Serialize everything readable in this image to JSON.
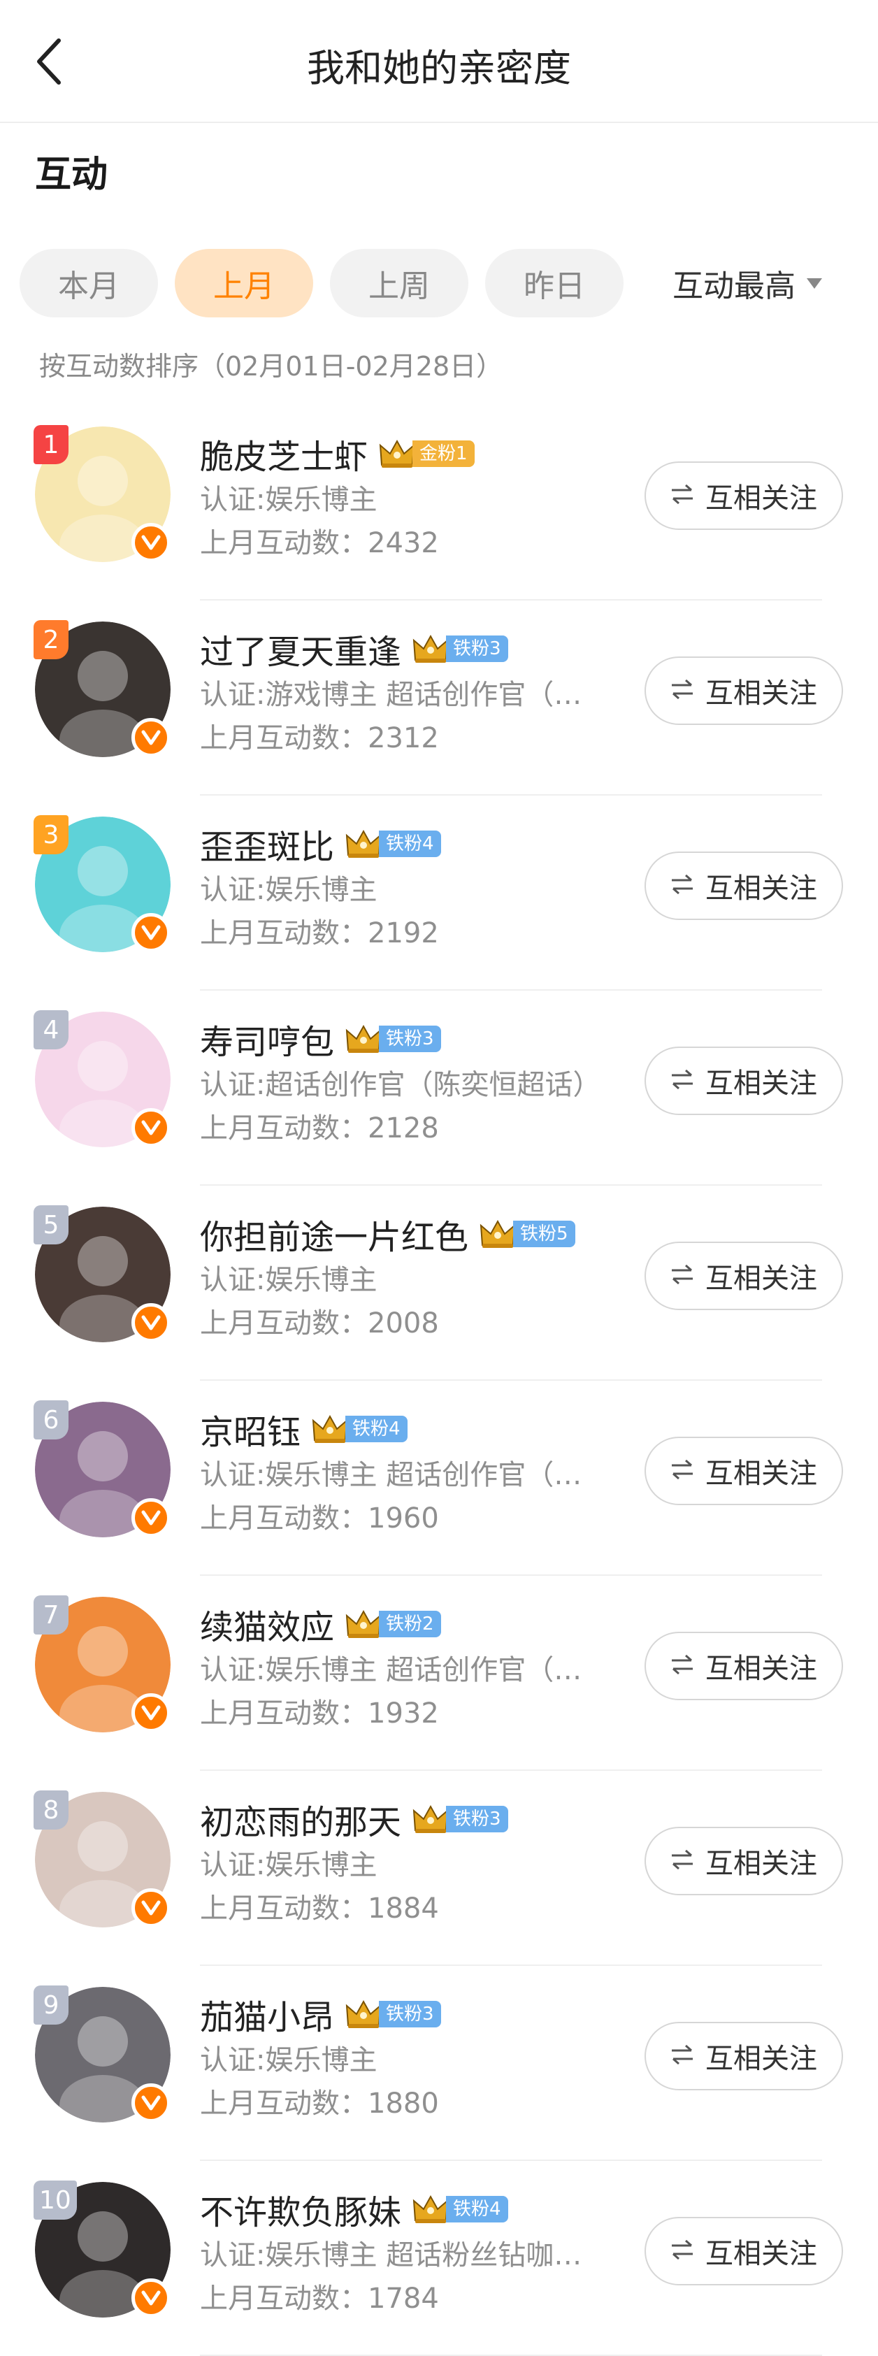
{
  "header": {
    "title": "我和她的亲密度"
  },
  "section": {
    "title": "互动"
  },
  "tabs": [
    {
      "label": "本月",
      "active": false
    },
    {
      "label": "上月",
      "active": true
    },
    {
      "label": "上周",
      "active": false
    },
    {
      "label": "昨日",
      "active": false
    }
  ],
  "sort": {
    "label": "互动最高"
  },
  "sort_hint": "按互动数排序（02月01日-02月28日）",
  "follow_label": "互相关注",
  "users": [
    {
      "rank": "1",
      "name": "脆皮芝士虾",
      "badge": "金粉1",
      "badge_type": "gold",
      "verify": "认证:娱乐博主",
      "count": "上月互动数：2432",
      "avatar_color": "#f7e7b0"
    },
    {
      "rank": "2",
      "name": "过了夏天重逢",
      "badge": "铁粉3",
      "badge_type": "iron",
      "verify": "认证:游戏博主 超话创作官（…",
      "count": "上月互动数：2312",
      "avatar_color": "#3a3431"
    },
    {
      "rank": "3",
      "name": "歪歪斑比",
      "badge": "铁粉4",
      "badge_type": "iron",
      "verify": "认证:娱乐博主",
      "count": "上月互动数：2192",
      "avatar_color": "#5ed2d8"
    },
    {
      "rank": "4",
      "name": "寿司哼包",
      "badge": "铁粉3",
      "badge_type": "iron",
      "verify": "认证:超话创作官（陈奕恒超话）",
      "count": "上月互动数：2128",
      "avatar_color": "#f6d7ea"
    },
    {
      "rank": "5",
      "name": "你担前途一片红色",
      "badge": "铁粉5",
      "badge_type": "iron",
      "verify": "认证:娱乐博主",
      "count": "上月互动数：2008",
      "avatar_color": "#4a3b36"
    },
    {
      "rank": "6",
      "name": "京昭钰",
      "badge": "铁粉4",
      "badge_type": "iron",
      "verify": "认证:娱乐博主 超话创作官（…",
      "count": "上月互动数：1960",
      "avatar_color": "#8a6a8e"
    },
    {
      "rank": "7",
      "name": "续猫效应",
      "badge": "铁粉2",
      "badge_type": "iron",
      "verify": "认证:娱乐博主 超话创作官（…",
      "count": "上月互动数：1932",
      "avatar_color": "#f08a3a"
    },
    {
      "rank": "8",
      "name": "初恋雨的那天",
      "badge": "铁粉3",
      "badge_type": "iron",
      "verify": "认证:娱乐博主",
      "count": "上月互动数：1884",
      "avatar_color": "#d9c7bf"
    },
    {
      "rank": "9",
      "name": "茄猫小昂",
      "badge": "铁粉3",
      "badge_type": "iron",
      "verify": "认证:娱乐博主",
      "count": "上月互动数：1880",
      "avatar_color": "#6c6a70"
    },
    {
      "rank": "10",
      "name": "不许欺负豚妹",
      "badge": "铁粉4",
      "badge_type": "iron",
      "verify": "认证:娱乐博主 超话粉丝钻咖…",
      "count": "上月互动数：1784",
      "avatar_color": "#2e2a2a"
    }
  ]
}
